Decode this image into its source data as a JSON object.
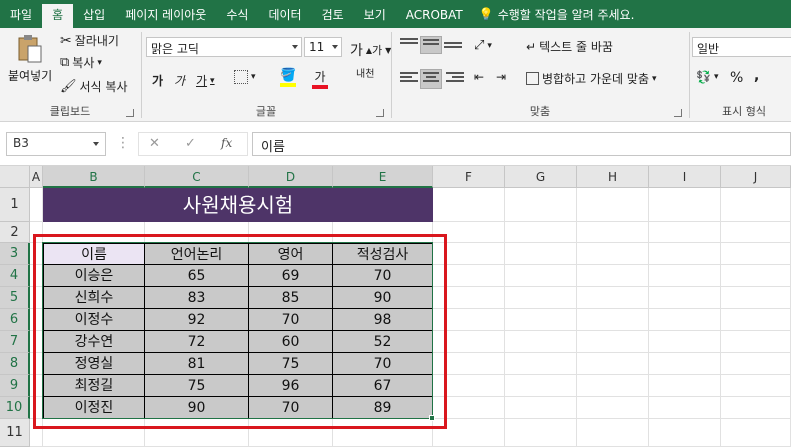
{
  "menu": {
    "tabs": [
      "파일",
      "홈",
      "삽입",
      "페이지 레이아웃",
      "수식",
      "데이터",
      "검토",
      "보기",
      "ACROBAT"
    ],
    "active_tab": 1,
    "tell_me": "수행할 작업을 알려 주세요."
  },
  "ribbon": {
    "clipboard": {
      "paste": "붙여넣기",
      "cut": "잘라내기",
      "copy": "복사",
      "format_painter": "서식 복사",
      "label": "클립보드"
    },
    "font": {
      "name": "맑은 고딕",
      "size": "11",
      "grow": "가",
      "shrink": "가",
      "bold": "가",
      "italic": "가",
      "underline": "가",
      "font_color_glyph": "가",
      "phonetic": "내천",
      "label": "글꼴"
    },
    "alignment": {
      "wrap_text": "텍스트 줄 바꿈",
      "merge_center": "병합하고 가운데 맞춤",
      "label": "맞춤"
    },
    "number": {
      "format": "일반",
      "percent": "%",
      "comma": ",",
      "label": "표시 형식"
    }
  },
  "formula_bar": {
    "name_box": "B3",
    "cancel": "✕",
    "enter": "✓",
    "fx": "fx",
    "content": "이름"
  },
  "sheet": {
    "columns": [
      "A",
      "B",
      "C",
      "D",
      "E",
      "F",
      "G",
      "H",
      "I",
      "J"
    ],
    "rows": [
      "1",
      "2",
      "3",
      "4",
      "5",
      "6",
      "7",
      "8",
      "9",
      "10",
      "11"
    ],
    "title": "사원채용시험",
    "headers": [
      "이름",
      "언어논리",
      "영어",
      "적성검사"
    ],
    "data": [
      [
        "이승은",
        "65",
        "69",
        "70"
      ],
      [
        "신희수",
        "83",
        "85",
        "90"
      ],
      [
        "이정수",
        "92",
        "70",
        "98"
      ],
      [
        "강수연",
        "72",
        "60",
        "52"
      ],
      [
        "정영실",
        "81",
        "75",
        "70"
      ],
      [
        "최정길",
        "75",
        "96",
        "67"
      ],
      [
        "이정진",
        "90",
        "70",
        "89"
      ]
    ]
  },
  "colors": {
    "excel_green": "#217346",
    "title_fill": "#4e3468",
    "highlight_red": "#d9171e"
  }
}
